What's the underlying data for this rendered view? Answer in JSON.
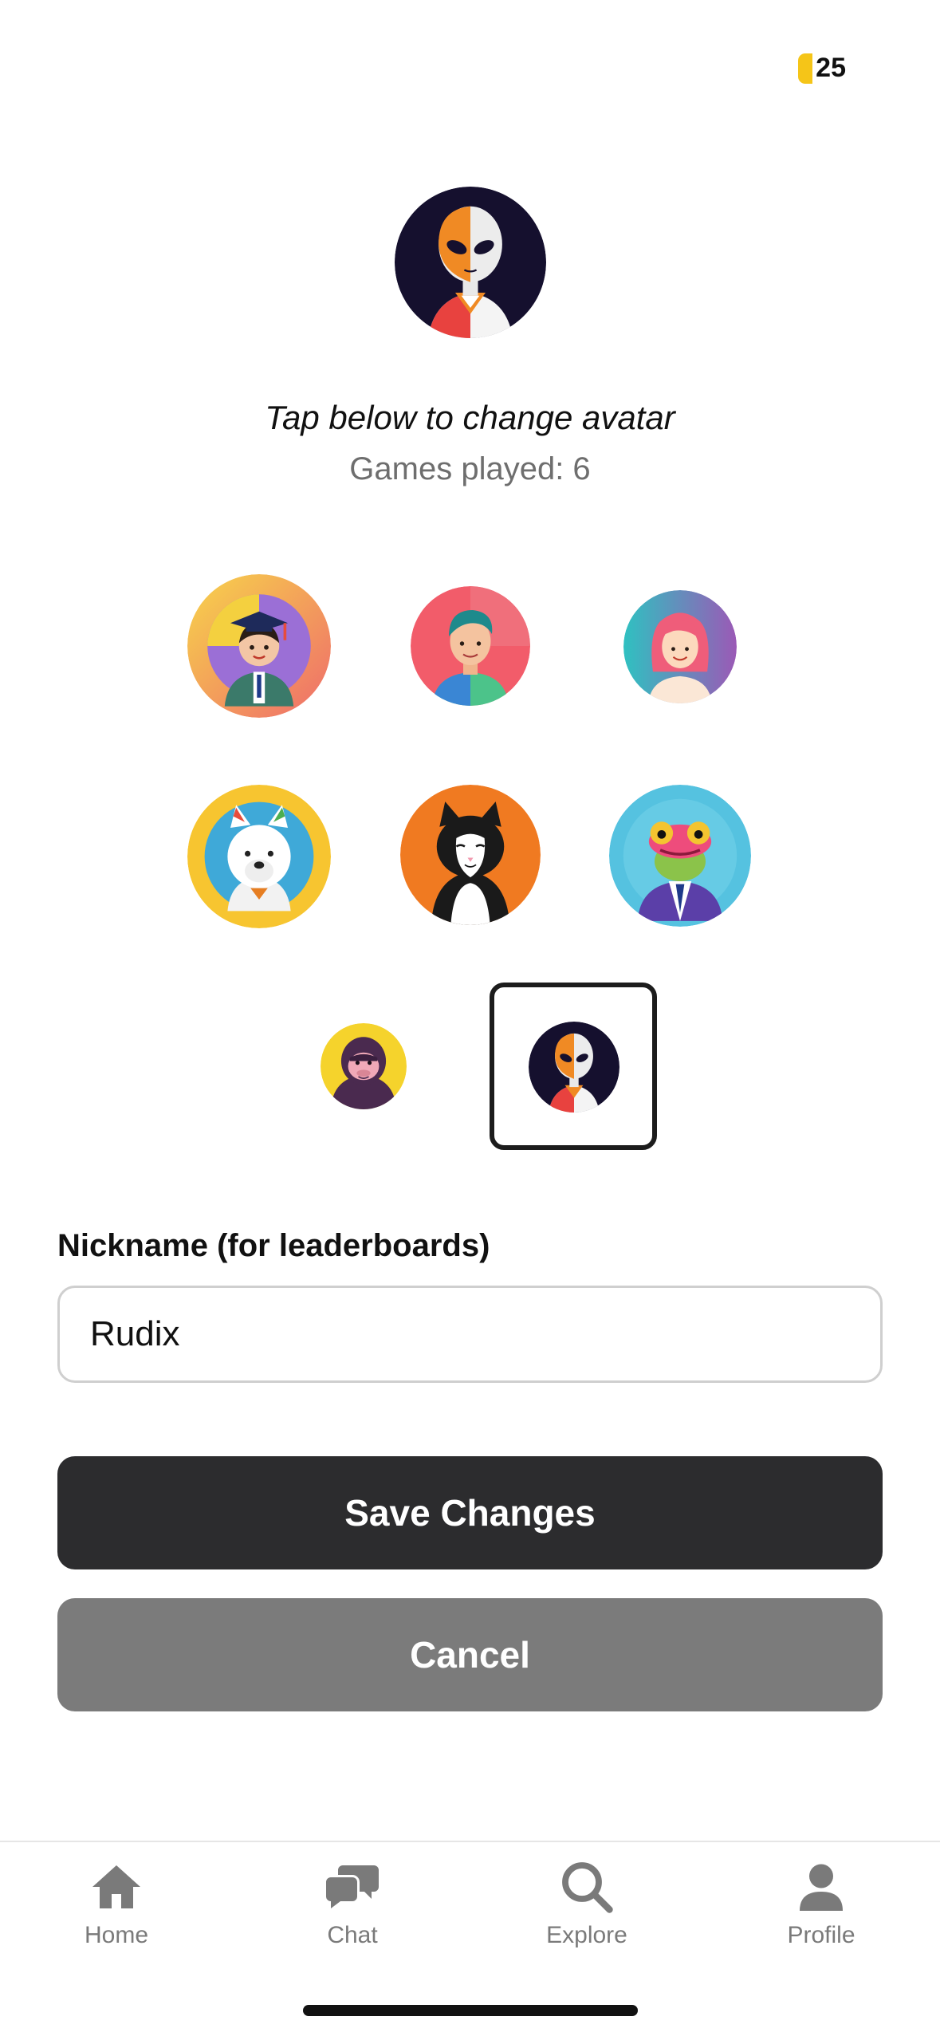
{
  "header": {
    "coin_count": "25",
    "coin_color": "#f5c518"
  },
  "profile": {
    "current_avatar": "alien",
    "tap_text": "Tap below to change avatar",
    "games_played": "Games played: 6"
  },
  "avatars": [
    {
      "id": "graduate",
      "icon": "graduate-avatar"
    },
    {
      "id": "boy",
      "icon": "boy-avatar"
    },
    {
      "id": "girl",
      "icon": "girl-avatar"
    },
    {
      "id": "dog",
      "icon": "dog-avatar"
    },
    {
      "id": "cat",
      "icon": "cat-avatar"
    },
    {
      "id": "frog",
      "icon": "frog-avatar"
    },
    {
      "id": "gorilla",
      "icon": "gorilla-avatar"
    },
    {
      "id": "alien",
      "icon": "alien-avatar",
      "selected": true
    }
  ],
  "nickname": {
    "label": "Nickname (for leaderboards)",
    "value": "Rudix"
  },
  "actions": {
    "save_label": "Save Changes",
    "cancel_label": "Cancel"
  },
  "tabbar": {
    "items": [
      {
        "label": "Home",
        "icon": "home-icon"
      },
      {
        "label": "Chat",
        "icon": "chat-icon"
      },
      {
        "label": "Explore",
        "icon": "search-icon"
      },
      {
        "label": "Profile",
        "icon": "profile-icon"
      }
    ]
  },
  "colors": {
    "primary_button": "#2c2c2e",
    "secondary_button": "#7b7b7b",
    "muted_text": "#6e6e6e"
  }
}
